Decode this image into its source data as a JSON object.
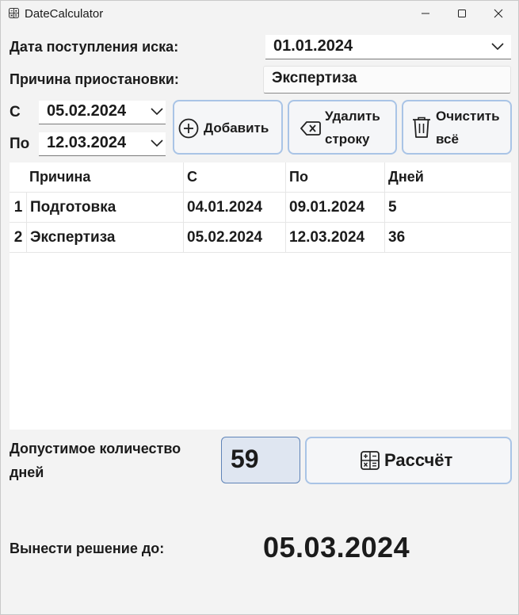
{
  "window": {
    "title": "DateCalculator"
  },
  "form": {
    "claim_date_label": "Дата поступления иска:",
    "claim_date_value": "01.01.2024",
    "reason_label": "Причина приостановки:",
    "reason_value": "Экспертиза",
    "from_label": "С",
    "from_value": "05.02.2024",
    "to_label": "По",
    "to_value": "12.03.2024"
  },
  "buttons": {
    "add_label": "Добавить",
    "delete_line1": "Удалить",
    "delete_line2": "строку",
    "clear_line1": "Очистить",
    "clear_line2": "всё",
    "calculate_label": "Рассчёт"
  },
  "table": {
    "headers": [
      "Причина",
      "С",
      "По",
      "Дней"
    ],
    "rows": [
      {
        "num": "1",
        "reason": "Подготовка",
        "from": "04.01.2024",
        "to": "09.01.2024",
        "days": "5"
      },
      {
        "num": "2",
        "reason": "Экспертиза",
        "from": "05.02.2024",
        "to": "12.03.2024",
        "days": "36"
      }
    ]
  },
  "allowed": {
    "label_line1": "Допустимое количество",
    "label_line2": "дней",
    "value": "59"
  },
  "decision": {
    "label": "Вынести решение до:",
    "value": "05.03.2024"
  },
  "icons": [
    "app-icon",
    "minimize-icon",
    "maximize-icon",
    "close-icon",
    "chevron-down-icon",
    "plus-circle-icon",
    "backspace-icon",
    "trash-icon",
    "calculator-icon"
  ]
}
